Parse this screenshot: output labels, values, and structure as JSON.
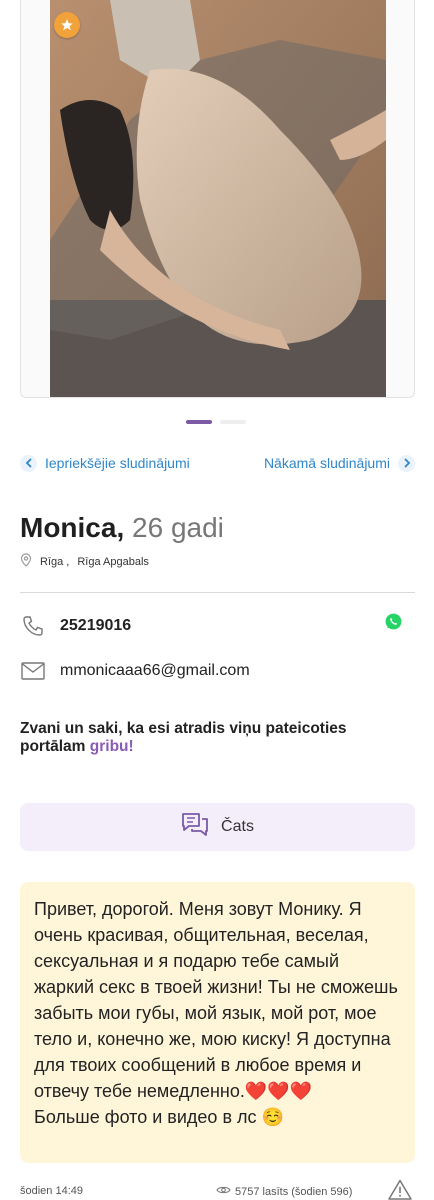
{
  "listing": {
    "name": "Monica,",
    "age": "26 gadi",
    "city": "Rīga ,",
    "region": "Rīga Apgabals"
  },
  "navigation": {
    "prev_label": "Iepriekšējie sludinājumi",
    "next_label": "Nākamā sludinājumi"
  },
  "gallery": {
    "total_photos": 2,
    "current_index": 1
  },
  "contact": {
    "phone": "25219016",
    "email": "mmonicaaa66@gmail.com"
  },
  "call_note": {
    "text": "Zvani un saki, ka esi atradis viņu pateicoties portālam",
    "brand": "gribu!"
  },
  "chat": {
    "label": "Čats"
  },
  "description": {
    "text": "Привет, дорогой. Меня зовут Монику. Я очень красивая, общительная, веселая, сексуальная и я подарю тебе самый жаркий секс в твоей жизни! Ты не сможешь забыть мои губы, мой язык, мой рот, мое тело и, конечно же, мою киску! Я доступна для твоих сообщений в любое время и отвечу тебе немедленно.❤️❤️❤️",
    "text2": "Больше фото и видео в лс ☺️"
  },
  "footer": {
    "posted": "šodien 14:49",
    "views": "5757 lasīts (šodien 596)"
  },
  "colors": {
    "accent_purple": "#7b5aa6",
    "link_blue": "#2f86c8",
    "chat_bg": "#f4eefb",
    "desc_bg": "#fff6da",
    "star_orange": "#f2a23a",
    "whatsapp_green": "#25d366"
  },
  "icons": {
    "featured": "star-icon",
    "prev": "chevron-left-icon",
    "next": "chevron-right-icon",
    "location": "location-pin-icon",
    "phone": "phone-icon",
    "whatsapp": "whatsapp-icon",
    "email": "envelope-icon",
    "chat": "chat-bubbles-icon",
    "views": "eye-icon",
    "report": "warning-triangle-icon"
  }
}
